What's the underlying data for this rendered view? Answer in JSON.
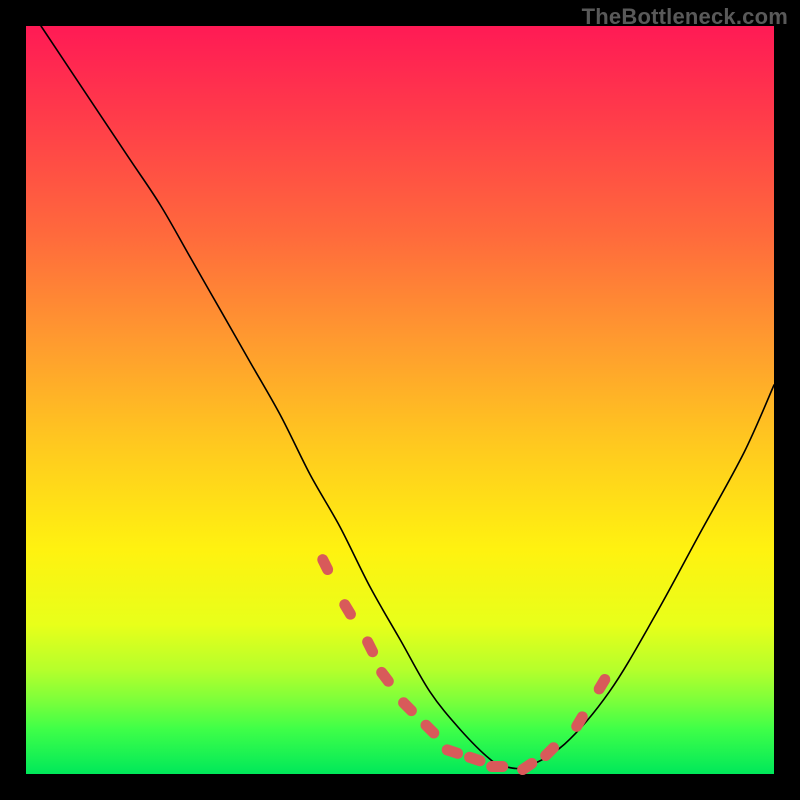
{
  "watermark": "TheBottleneck.com",
  "chart_data": {
    "type": "line",
    "title": "",
    "xlabel": "",
    "ylabel": "",
    "xlim": [
      0,
      100
    ],
    "ylim": [
      0,
      100
    ],
    "grid": false,
    "legend": false,
    "background_gradient": {
      "orientation": "vertical",
      "stops": [
        {
          "pos": 0,
          "color": "#ff1a55"
        },
        {
          "pos": 50,
          "color": "#ffcc20"
        },
        {
          "pos": 80,
          "color": "#f5ff20"
        },
        {
          "pos": 100,
          "color": "#00e85a"
        }
      ]
    },
    "series": [
      {
        "name": "curve",
        "color": "#000000",
        "x": [
          2,
          6,
          10,
          14,
          18,
          22,
          26,
          30,
          34,
          38,
          42,
          46,
          50,
          54,
          58,
          62,
          64,
          67,
          72,
          78,
          84,
          90,
          96,
          100
        ],
        "y": [
          100,
          94,
          88,
          82,
          76,
          69,
          62,
          55,
          48,
          40,
          33,
          25,
          18,
          11,
          6,
          2,
          1,
          1,
          4,
          11,
          21,
          32,
          43,
          52
        ]
      },
      {
        "name": "highlight-blobs",
        "color": "#d85a5a",
        "type": "scatter",
        "x": [
          40,
          43,
          46,
          48,
          51,
          54,
          57,
          60,
          63,
          67,
          70,
          74,
          77
        ],
        "y": [
          28,
          22,
          17,
          13,
          9,
          6,
          3,
          2,
          1,
          1,
          3,
          7,
          12
        ]
      }
    ]
  }
}
